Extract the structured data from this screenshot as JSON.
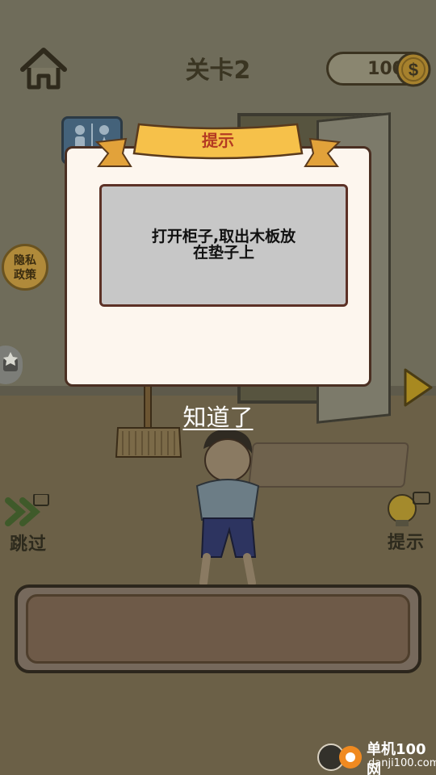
{
  "header": {
    "level_title": "关卡2",
    "coins": "100",
    "coin_symbol": "$"
  },
  "side": {
    "privacy_label_line1": "隐私",
    "privacy_label_line2": "政策",
    "skip_label": "跳过",
    "hint_label": "提示"
  },
  "dialog": {
    "title": "提示",
    "hint_line1": "打开柜子,取出木板放",
    "hint_line2": "在垫子上",
    "confirm_label": "知道了"
  },
  "watermark": {
    "line1": "单机100网",
    "line2": "danji100.com"
  },
  "colors": {
    "banner_yellow": "#f6c14a",
    "banner_text": "#b43a22",
    "dialog_bg": "#fdf6ee",
    "hint_box": "#c7c7c7",
    "overlay": "#3b3a2c"
  },
  "icons": [
    "home-icon",
    "coin-icon",
    "restroom-sign-icon",
    "share-icon",
    "next-arrow-icon",
    "skip-arrows-icon",
    "video-icon",
    "lightbulb-icon",
    "broom-icon"
  ]
}
